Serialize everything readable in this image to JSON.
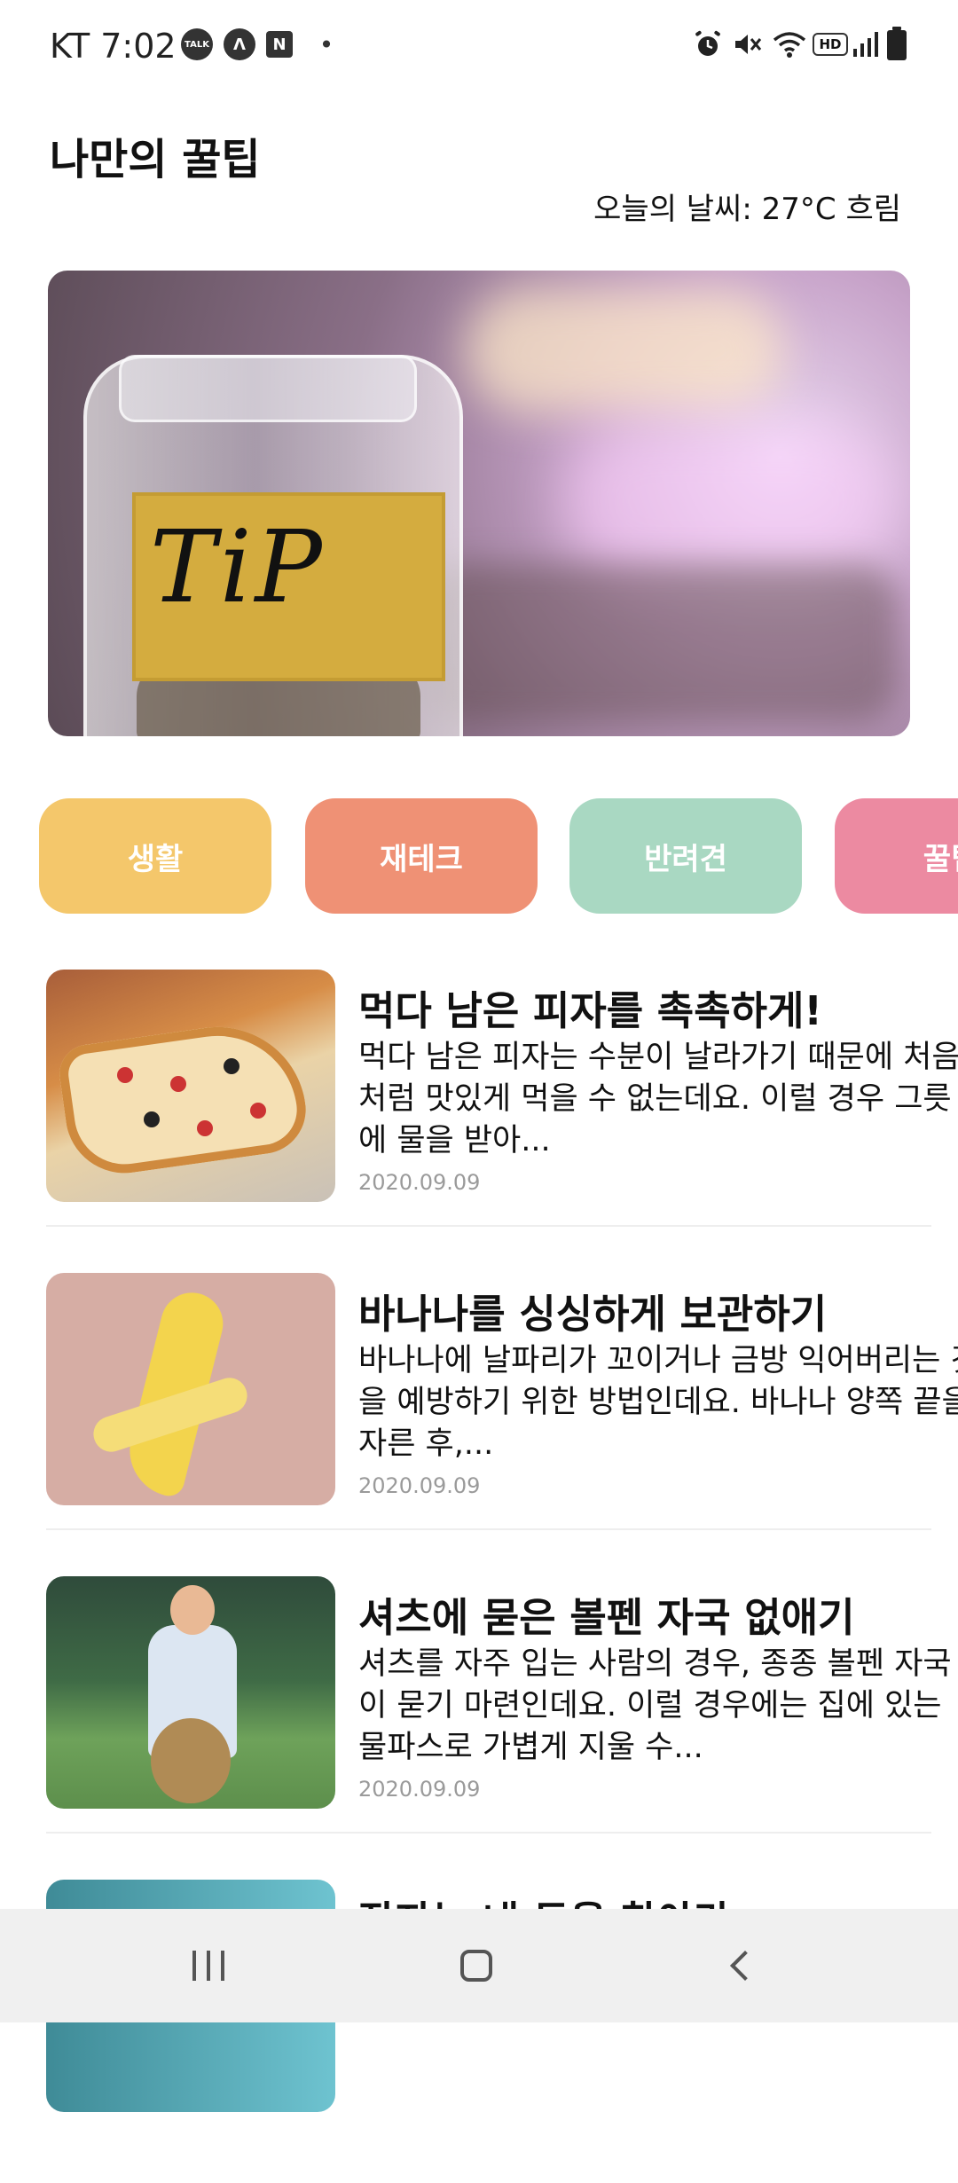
{
  "status_bar": {
    "carrier_time": "KT 7:02",
    "talk_label": "TALK",
    "nav_icon_label": "Λ",
    "naver_label": "N",
    "dot": "•",
    "hd_label": "HD",
    "icons": [
      "kakaotalk-icon",
      "navigation-icon",
      "naver-icon",
      "alarm-icon",
      "mute-icon",
      "wifi-icon",
      "hd-icon",
      "signal-icon",
      "battery-icon"
    ]
  },
  "header": {
    "title": "나만의 꿀팁",
    "weather": "오늘의 날씨: 27°C 흐림"
  },
  "hero": {
    "tip_text": "TiP"
  },
  "categories": [
    {
      "label": "생활",
      "color": "#f4c76b"
    },
    {
      "label": "재테크",
      "color": "#ef9175"
    },
    {
      "label": "반려견",
      "color": "#a9d8c2"
    },
    {
      "label": "꿀팁",
      "color": "#ec8aa1"
    }
  ],
  "articles": [
    {
      "title": "먹다 남은 피자를 촉촉하게!",
      "desc": "먹다 남은 피자는 수분이 날라가기 때문에 처음처럼 맛있게 먹을 수 없는데요. 이럴 경우 그릇에 물을 받아...",
      "date": "2020.09.09",
      "thumb": "pizza"
    },
    {
      "title": "바나나를 싱싱하게 보관하기",
      "desc": "바나나에 날파리가 꼬이거나 금방 익어버리는 것을 예방하기 위한 방법인데요. 바나나 양쪽 끝을 자른 후,...",
      "date": "2020.09.09",
      "thumb": "banana"
    },
    {
      "title": "셔츠에 묻은 볼펜 자국 없애기",
      "desc": "셔츠를 자주 입는 사람의 경우, 종종 볼펜 자국이 묻기 마련인데요. 이럴 경우에는 집에 있는 물파스로 가볍게 지울 수...",
      "date": "2020.09.09",
      "thumb": "boy"
    },
    {
      "title": "잠자는 내 돈을 찾아라",
      "desc": "",
      "date": "",
      "thumb": "teal"
    }
  ]
}
